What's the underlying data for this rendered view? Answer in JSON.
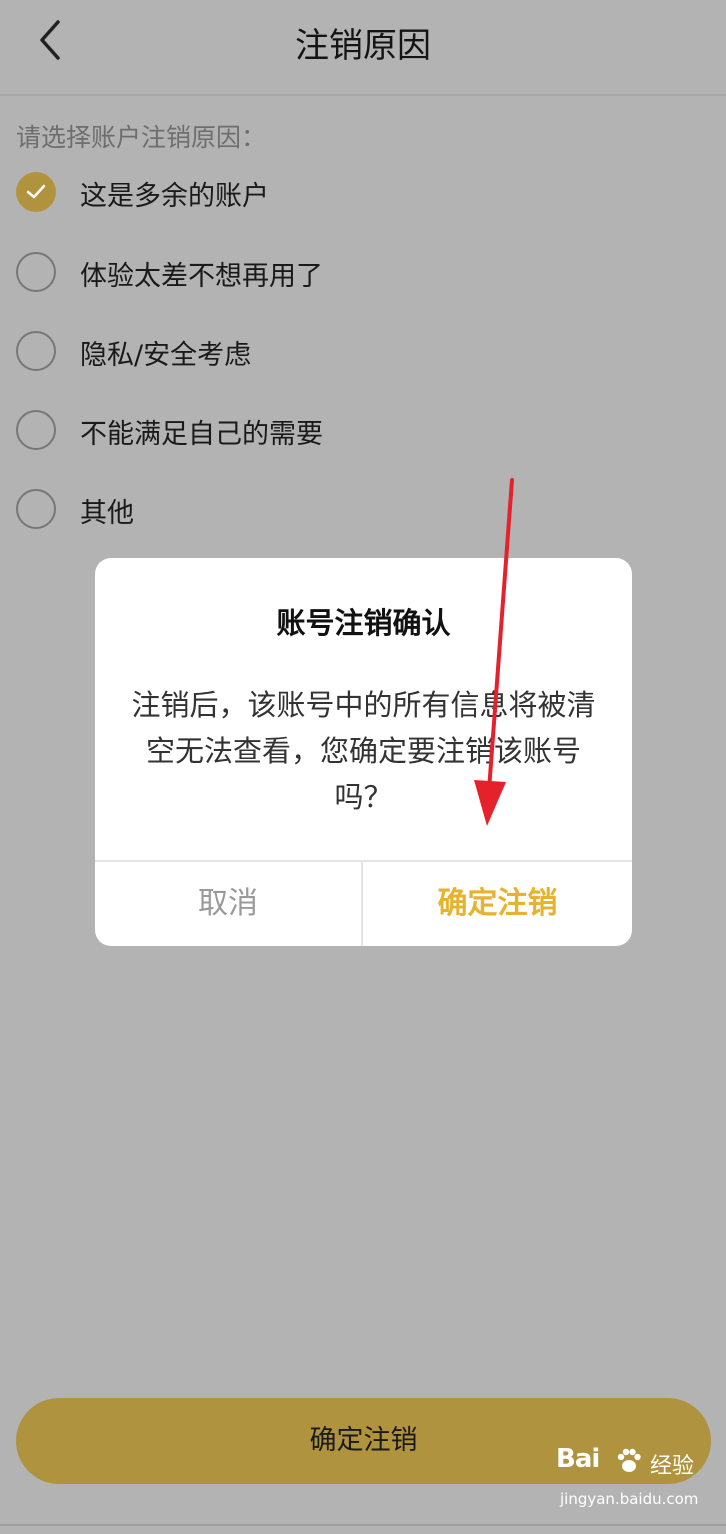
{
  "header": {
    "title": "注销原因"
  },
  "prompt": "请选择账户注销原因：",
  "options": [
    {
      "label": "这是多余的账户",
      "checked": true
    },
    {
      "label": "体验太差不想再用了",
      "checked": false
    },
    {
      "label": "隐私/安全考虑",
      "checked": false
    },
    {
      "label": "不能满足自己的需要",
      "checked": false
    },
    {
      "label": "其他",
      "checked": false
    }
  ],
  "dialog": {
    "title": "账号注销确认",
    "message": "注销后，该账号中的所有信息将被清空无法查看，您确定要注销该账号吗？",
    "cancel_label": "取消",
    "confirm_label": "确定注销"
  },
  "bottom_button": {
    "label": "确定注销"
  },
  "watermark": {
    "brand": "Bai",
    "text": "经验",
    "url": "jingyan.baidu.com"
  },
  "colors": {
    "accent": "#b0933f",
    "confirm_text": "#e6b32e",
    "overlay_bg": "#b3b3b3",
    "arrow": "#e5222b"
  },
  "icons": {
    "back": "chevron-left-icon",
    "check": "check-icon",
    "annotation": "red-arrow-annotation"
  }
}
